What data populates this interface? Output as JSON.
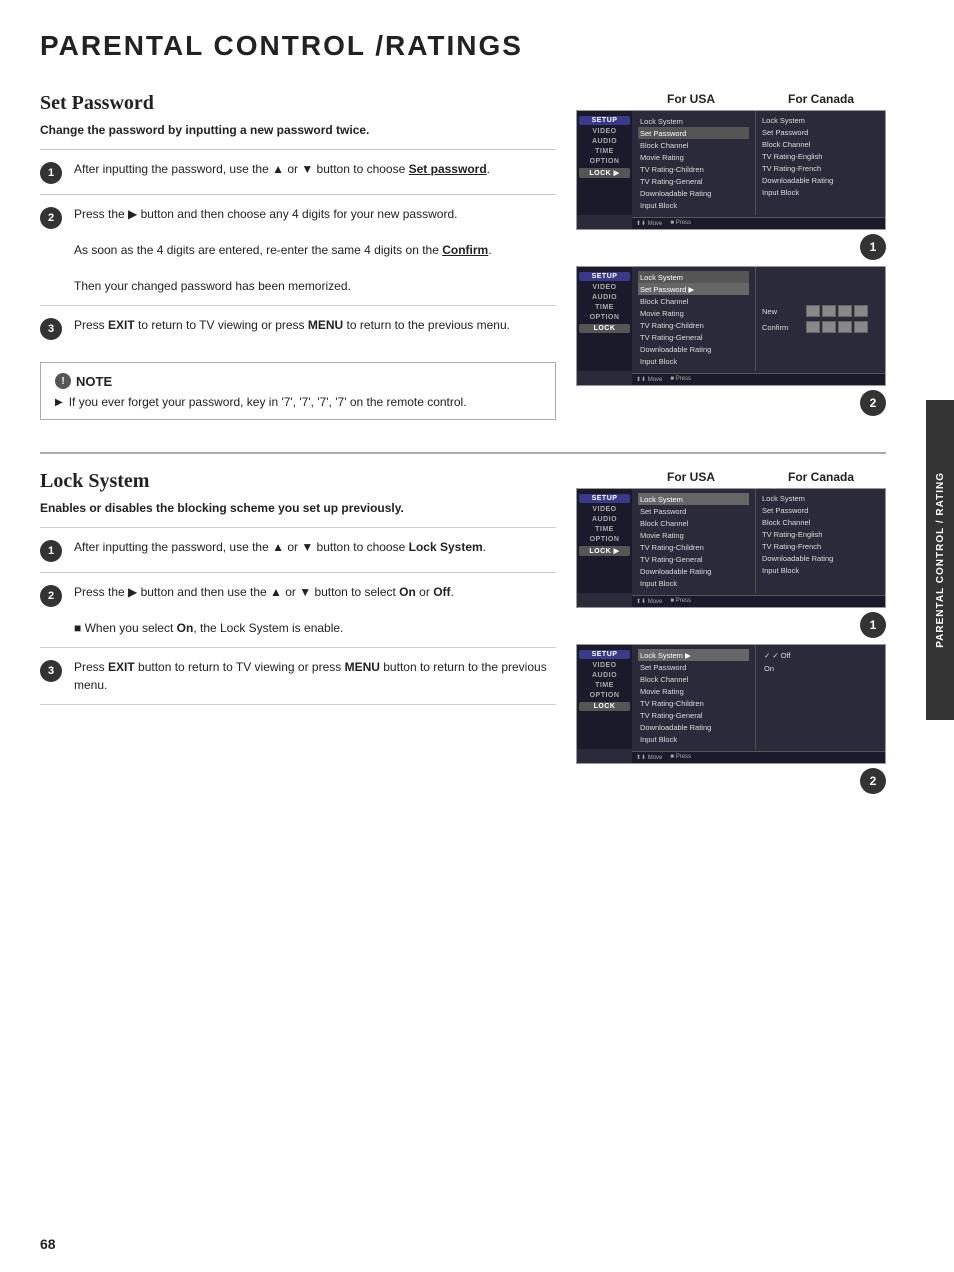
{
  "page": {
    "title": "PARENTAL CONTROL /RATINGS",
    "page_number": "68",
    "side_tab": "PARENTAL CONTROL / RATING"
  },
  "set_password": {
    "title": "Set Password",
    "subtitle": "Change the password by inputting a new password twice.",
    "steps": [
      {
        "number": "1",
        "text_parts": [
          {
            "text": "After inputting the password, use the ▲ or ▼ button to choose ",
            "bold": false
          },
          {
            "text": "Set password",
            "bold": true,
            "underline": true
          },
          {
            "text": ".",
            "bold": false
          }
        ],
        "text": "After inputting the password, use the ▲ or ▼ button to choose Set password."
      },
      {
        "number": "2",
        "text_parts": [
          {
            "text": "Press the ▶ button and then choose any 4 digits for your new password.\n\nAs soon as the 4 digits are entered, re-enter the same 4 digits on the ",
            "bold": false
          },
          {
            "text": "Confirm",
            "bold": true,
            "underline": true
          },
          {
            "text": ".\n\nThen your changed password has been memorized.",
            "bold": false
          }
        ],
        "text": "Press the ▶ button and then choose any 4 digits for your new password.\n\nAs soon as the 4 digits are entered, re-enter the same 4 digits on the Confirm.\n\nThen your changed password has been memorized."
      },
      {
        "number": "3",
        "text_parts": [
          {
            "text": "Press ",
            "bold": false
          },
          {
            "text": "EXIT",
            "bold": true
          },
          {
            "text": " to return to TV viewing or press ",
            "bold": false
          },
          {
            "text": "MENU",
            "bold": true
          },
          {
            "text": " to return to the previous menu.",
            "bold": false
          }
        ],
        "text": "Press EXIT to return to TV viewing or press MENU to return to the previous menu."
      }
    ],
    "note": {
      "title": "NOTE",
      "items": [
        "If you ever forget your password, key in '7', '7', '7', '7' on the remote control."
      ]
    }
  },
  "lock_system": {
    "title": "Lock System",
    "subtitle": "Enables or disables the blocking scheme you set up previously.",
    "steps": [
      {
        "number": "1",
        "text": "After inputting the password, use the ▲ or ▼ button to choose Lock System.",
        "bold_word": "Lock System"
      },
      {
        "number": "2",
        "text": "Press the ▶ button and then use the ▲ or ▼ button to select On or Off.",
        "note": "When you select On, the Lock System is enable."
      },
      {
        "number": "3",
        "text": "Press EXIT button to return to TV viewing or press MENU button to return to the previous menu."
      }
    ]
  },
  "menus": {
    "sidebar_items": [
      "SETUP",
      "VIDEO",
      "AUDIO",
      "TIME",
      "OPTION",
      "LOCK"
    ],
    "main_menu_items": [
      "Lock System",
      "Set Password",
      "Block Channel",
      "Movie Rating",
      "TV Rating-Children",
      "TV Rating-General",
      "Downloadable Rating",
      "Input Block"
    ],
    "canada_menu_items": [
      "Lock System",
      "Set Password",
      "Block Channel",
      "TV Rating-English",
      "TV Rating-French",
      "Downloadable Rating",
      "Input Block"
    ],
    "footer": [
      "Move",
      "Press"
    ],
    "for_usa": "For USA",
    "for_canada": "For Canada"
  },
  "password_screen": {
    "new_label": "New",
    "confirm_label": "Confirm"
  },
  "lock_submenu": {
    "items": [
      "✓ Off",
      "On"
    ]
  }
}
